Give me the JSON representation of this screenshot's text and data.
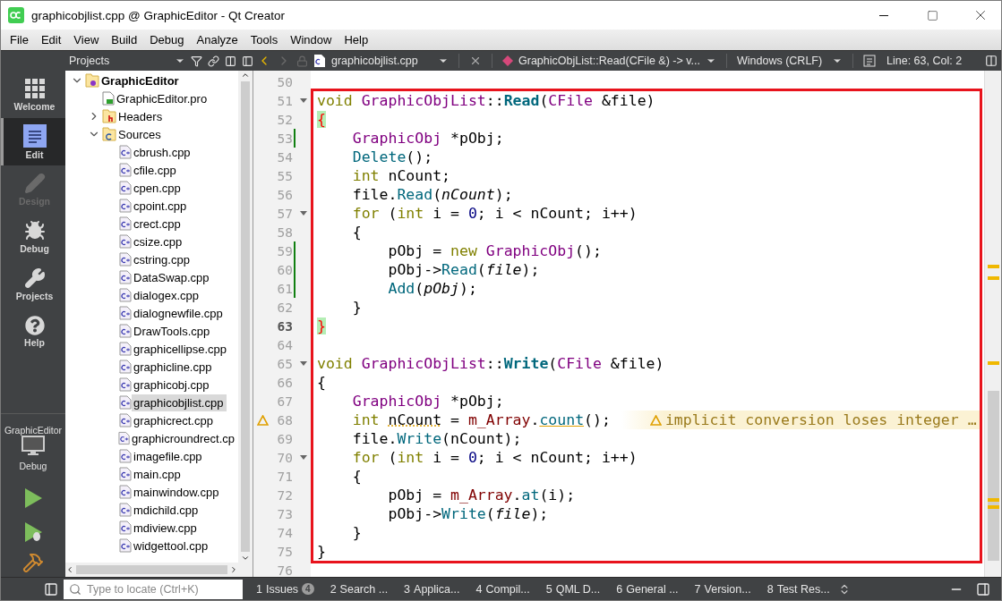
{
  "window": {
    "title": "graphicobjlist.cpp @ GraphicEditor - Qt Creator"
  },
  "menu": [
    "File",
    "Edit",
    "View",
    "Build",
    "Debug",
    "Analyze",
    "Tools",
    "Window",
    "Help"
  ],
  "modes": [
    {
      "label": "Welcome",
      "selected": false,
      "disabled": false
    },
    {
      "label": "Edit",
      "selected": true,
      "disabled": false
    },
    {
      "label": "Design",
      "selected": false,
      "disabled": true
    },
    {
      "label": "Debug",
      "selected": false,
      "disabled": false
    },
    {
      "label": "Projects",
      "selected": false,
      "disabled": false
    },
    {
      "label": "Help",
      "selected": false,
      "disabled": false
    }
  ],
  "target": {
    "project": "GraphicEditor",
    "config": "Debug"
  },
  "projects_pane": {
    "title": "Projects"
  },
  "tree": [
    {
      "label": "GraphicEditor",
      "kind": "project",
      "expanded": true,
      "selected": false,
      "children": [
        {
          "label": "GraphicEditor.pro",
          "kind": "pro",
          "selected": false
        },
        {
          "label": "Headers",
          "kind": "headers",
          "expanded": false,
          "selected": false
        },
        {
          "label": "Sources",
          "kind": "sources",
          "expanded": true,
          "selected": false,
          "children": [
            {
              "label": "cbrush.cpp",
              "kind": "cpp",
              "selected": false
            },
            {
              "label": "cfile.cpp",
              "kind": "cpp",
              "selected": false
            },
            {
              "label": "cpen.cpp",
              "kind": "cpp",
              "selected": false
            },
            {
              "label": "cpoint.cpp",
              "kind": "cpp",
              "selected": false
            },
            {
              "label": "crect.cpp",
              "kind": "cpp",
              "selected": false
            },
            {
              "label": "csize.cpp",
              "kind": "cpp",
              "selected": false
            },
            {
              "label": "cstring.cpp",
              "kind": "cpp",
              "selected": false
            },
            {
              "label": "DataSwap.cpp",
              "kind": "cpp",
              "selected": false
            },
            {
              "label": "dialogex.cpp",
              "kind": "cpp",
              "selected": false
            },
            {
              "label": "dialognewfile.cpp",
              "kind": "cpp",
              "selected": false
            },
            {
              "label": "DrawTools.cpp",
              "kind": "cpp",
              "selected": false
            },
            {
              "label": "graphicellipse.cpp",
              "kind": "cpp",
              "selected": false
            },
            {
              "label": "graphicline.cpp",
              "kind": "cpp",
              "selected": false
            },
            {
              "label": "graphicobj.cpp",
              "kind": "cpp",
              "selected": false
            },
            {
              "label": "graphicobjlist.cpp",
              "kind": "cpp",
              "selected": true
            },
            {
              "label": "graphicrect.cpp",
              "kind": "cpp",
              "selected": false
            },
            {
              "label": "graphicroundrect.cp",
              "kind": "cpp",
              "selected": false
            },
            {
              "label": "imagefile.cpp",
              "kind": "cpp",
              "selected": false
            },
            {
              "label": "main.cpp",
              "kind": "cpp",
              "selected": false
            },
            {
              "label": "mainwindow.cpp",
              "kind": "cpp",
              "selected": false
            },
            {
              "label": "mdichild.cpp",
              "kind": "cpp",
              "selected": false
            },
            {
              "label": "mdiview.cpp",
              "kind": "cpp",
              "selected": false
            },
            {
              "label": "widgettool.cpp",
              "kind": "cpp",
              "selected": false
            }
          ]
        }
      ]
    }
  ],
  "editor_toolbar": {
    "file": "graphicobjlist.cpp",
    "symbol": "GraphicObjList::Read(CFile &) -> v...",
    "line_endings": "Windows (CRLF)",
    "position": "Line: 63, Col: 2"
  },
  "code_blocks": [
    {
      "kind": "plain",
      "lines": [
        {
          "number": "50",
          "fold": false,
          "changed": false,
          "current": false,
          "warning": false
        }
      ]
    },
    {
      "kind": "framed",
      "lines": [
        {
          "number": "51",
          "fold": true,
          "changed": false,
          "current": false,
          "warning": false,
          "tokens": [
            {
              "kind": "keyword",
              "text": "void"
            },
            {
              "kind": "type",
              "text": " GraphicObjList"
            },
            {
              "kind": "plain",
              "text": "::"
            },
            {
              "kind": "declaration",
              "text": "Read"
            },
            {
              "kind": "plain",
              "text": "("
            },
            {
              "kind": "type",
              "text": "CFile"
            },
            {
              "kind": "plain",
              "text": " &file)"
            }
          ]
        },
        {
          "number": "52",
          "fold": false,
          "changed": false,
          "current": false,
          "warning": false,
          "tokens": [
            {
              "kind": "brace",
              "text": "{"
            }
          ]
        },
        {
          "number": "53",
          "fold": false,
          "changed": true,
          "current": false,
          "warning": false,
          "tokens": [
            {
              "kind": "type",
              "text": "    GraphicObj"
            },
            {
              "kind": "plain",
              "text": " *pObj;"
            }
          ]
        },
        {
          "number": "54",
          "fold": false,
          "changed": false,
          "current": false,
          "warning": false,
          "tokens": [
            {
              "kind": "function",
              "text": "    Delete"
            },
            {
              "kind": "plain",
              "text": "();"
            }
          ]
        },
        {
          "number": "55",
          "fold": false,
          "changed": false,
          "current": false,
          "warning": false,
          "tokens": [
            {
              "kind": "keyword",
              "text": "    int"
            },
            {
              "kind": "plain",
              "text": " nCount;"
            }
          ]
        },
        {
          "number": "56",
          "fold": false,
          "changed": false,
          "current": false,
          "warning": false,
          "tokens": [
            {
              "kind": "plain",
              "text": "    file."
            },
            {
              "kind": "function",
              "text": "Read"
            },
            {
              "kind": "plain",
              "text": "("
            },
            {
              "kind": "parameter",
              "text": "nCount"
            },
            {
              "kind": "plain",
              "text": ");"
            }
          ]
        },
        {
          "number": "57",
          "fold": true,
          "changed": false,
          "current": false,
          "warning": false,
          "tokens": [
            {
              "kind": "keyword",
              "text": "    for"
            },
            {
              "kind": "plain",
              "text": " ("
            },
            {
              "kind": "keyword",
              "text": "int"
            },
            {
              "kind": "plain",
              "text": " i = "
            },
            {
              "kind": "number",
              "text": "0"
            },
            {
              "kind": "plain",
              "text": "; i < nCount; i++)"
            }
          ]
        },
        {
          "number": "58",
          "fold": false,
          "changed": false,
          "current": false,
          "warning": false,
          "tokens": [
            {
              "kind": "plain",
              "text": "    {"
            }
          ]
        },
        {
          "number": "59",
          "fold": false,
          "changed": true,
          "current": false,
          "warning": false,
          "tokens": [
            {
              "kind": "plain",
              "text": "        pObj = "
            },
            {
              "kind": "keyword",
              "text": "new"
            },
            {
              "kind": "type",
              "text": " GraphicObj"
            },
            {
              "kind": "plain",
              "text": "();"
            }
          ]
        },
        {
          "number": "60",
          "fold": false,
          "changed": true,
          "current": false,
          "warning": false,
          "tokens": [
            {
              "kind": "plain",
              "text": "        pObj->"
            },
            {
              "kind": "function",
              "text": "Read"
            },
            {
              "kind": "plain",
              "text": "("
            },
            {
              "kind": "parameter",
              "text": "file"
            },
            {
              "kind": "plain",
              "text": ");"
            }
          ]
        },
        {
          "number": "61",
          "fold": false,
          "changed": true,
          "current": false,
          "warning": false,
          "tokens": [
            {
              "kind": "function",
              "text": "        Add"
            },
            {
              "kind": "plain",
              "text": "("
            },
            {
              "kind": "parameter",
              "text": "pObj"
            },
            {
              "kind": "plain",
              "text": ");"
            }
          ]
        },
        {
          "number": "62",
          "fold": false,
          "changed": false,
          "current": false,
          "warning": false,
          "tokens": [
            {
              "kind": "plain",
              "text": "    }"
            }
          ]
        },
        {
          "number": "63",
          "fold": false,
          "changed": false,
          "current": true,
          "warning": false,
          "tokens": [
            {
              "kind": "brace",
              "text": "}"
            }
          ]
        },
        {
          "number": "64",
          "fold": false,
          "changed": false,
          "current": false,
          "warning": false
        },
        {
          "number": "65",
          "fold": true,
          "changed": false,
          "current": false,
          "warning": false,
          "tokens": [
            {
              "kind": "keyword",
              "text": "void"
            },
            {
              "kind": "type",
              "text": " GraphicObjList"
            },
            {
              "kind": "plain",
              "text": "::"
            },
            {
              "kind": "declaration",
              "text": "Write"
            },
            {
              "kind": "plain",
              "text": "("
            },
            {
              "kind": "type",
              "text": "CFile"
            },
            {
              "kind": "plain",
              "text": " &file)"
            }
          ]
        },
        {
          "number": "66",
          "fold": false,
          "changed": false,
          "current": false,
          "warning": false,
          "tokens": [
            {
              "kind": "plain",
              "text": "{"
            }
          ]
        },
        {
          "number": "67",
          "fold": false,
          "changed": false,
          "current": false,
          "warning": false,
          "tokens": [
            {
              "kind": "type",
              "text": "    GraphicObj"
            },
            {
              "kind": "plain",
              "text": " *pObj;"
            }
          ]
        },
        {
          "number": "68",
          "fold": false,
          "changed": false,
          "current": false,
          "warning": true,
          "annotation": "implicit conversion loses integer …",
          "tokens": [
            {
              "kind": "keyword",
              "text": "    int "
            },
            {
              "kind": "flagged",
              "text": "nCount"
            },
            {
              "kind": "plain",
              "text": " = "
            },
            {
              "kind": "member",
              "text": "m_Array"
            },
            {
              "kind": "plain",
              "text": "."
            },
            {
              "kind": "flaggedcall",
              "text": "count"
            },
            {
              "kind": "plain",
              "text": "();"
            }
          ]
        },
        {
          "number": "69",
          "fold": false,
          "changed": false,
          "current": false,
          "warning": false,
          "tokens": [
            {
              "kind": "plain",
              "text": "    file."
            },
            {
              "kind": "function",
              "text": "Write"
            },
            {
              "kind": "plain",
              "text": "(nCount);"
            }
          ]
        },
        {
          "number": "70",
          "fold": true,
          "changed": false,
          "current": false,
          "warning": false,
          "tokens": [
            {
              "kind": "keyword",
              "text": "    for"
            },
            {
              "kind": "plain",
              "text": " ("
            },
            {
              "kind": "keyword",
              "text": "int"
            },
            {
              "kind": "plain",
              "text": " i = "
            },
            {
              "kind": "number",
              "text": "0"
            },
            {
              "kind": "plain",
              "text": "; i < nCount; i++)"
            }
          ]
        },
        {
          "number": "71",
          "fold": false,
          "changed": false,
          "current": false,
          "warning": false,
          "tokens": [
            {
              "kind": "plain",
              "text": "    {"
            }
          ]
        },
        {
          "number": "72",
          "fold": false,
          "changed": false,
          "current": false,
          "warning": false,
          "tokens": [
            {
              "kind": "plain",
              "text": "        pObj = "
            },
            {
              "kind": "member",
              "text": "m_Array"
            },
            {
              "kind": "plain",
              "text": "."
            },
            {
              "kind": "function",
              "text": "at"
            },
            {
              "kind": "plain",
              "text": "(i);"
            }
          ]
        },
        {
          "number": "73",
          "fold": false,
          "changed": false,
          "current": false,
          "warning": false,
          "tokens": [
            {
              "kind": "plain",
              "text": "        pObj->"
            },
            {
              "kind": "function",
              "text": "Write"
            },
            {
              "kind": "plain",
              "text": "("
            },
            {
              "kind": "parameter",
              "text": "file"
            },
            {
              "kind": "plain",
              "text": ");"
            }
          ]
        },
        {
          "number": "74",
          "fold": false,
          "changed": false,
          "current": false,
          "warning": false,
          "tokens": [
            {
              "kind": "plain",
              "text": "    }"
            }
          ]
        },
        {
          "number": "75",
          "fold": false,
          "changed": false,
          "current": false,
          "warning": false,
          "tokens": [
            {
              "kind": "plain",
              "text": "}"
            }
          ]
        }
      ]
    },
    {
      "kind": "plain",
      "lines": [
        {
          "number": "76",
          "fold": false,
          "changed": false,
          "current": false,
          "warning": false
        }
      ]
    }
  ],
  "locator": {
    "placeholder": "Type to locate (Ctrl+K)"
  },
  "output_tabs": [
    {
      "number": "1",
      "label": "Issues",
      "badge": "4"
    },
    {
      "number": "2",
      "label": "Search ..."
    },
    {
      "number": "3",
      "label": "Applica..."
    },
    {
      "number": "4",
      "label": "Compil..."
    },
    {
      "number": "5",
      "label": "QML D..."
    },
    {
      "number": "6",
      "label": "General ..."
    },
    {
      "number": "7",
      "label": "Version..."
    },
    {
      "number": "8",
      "label": "Test Res..."
    }
  ]
}
